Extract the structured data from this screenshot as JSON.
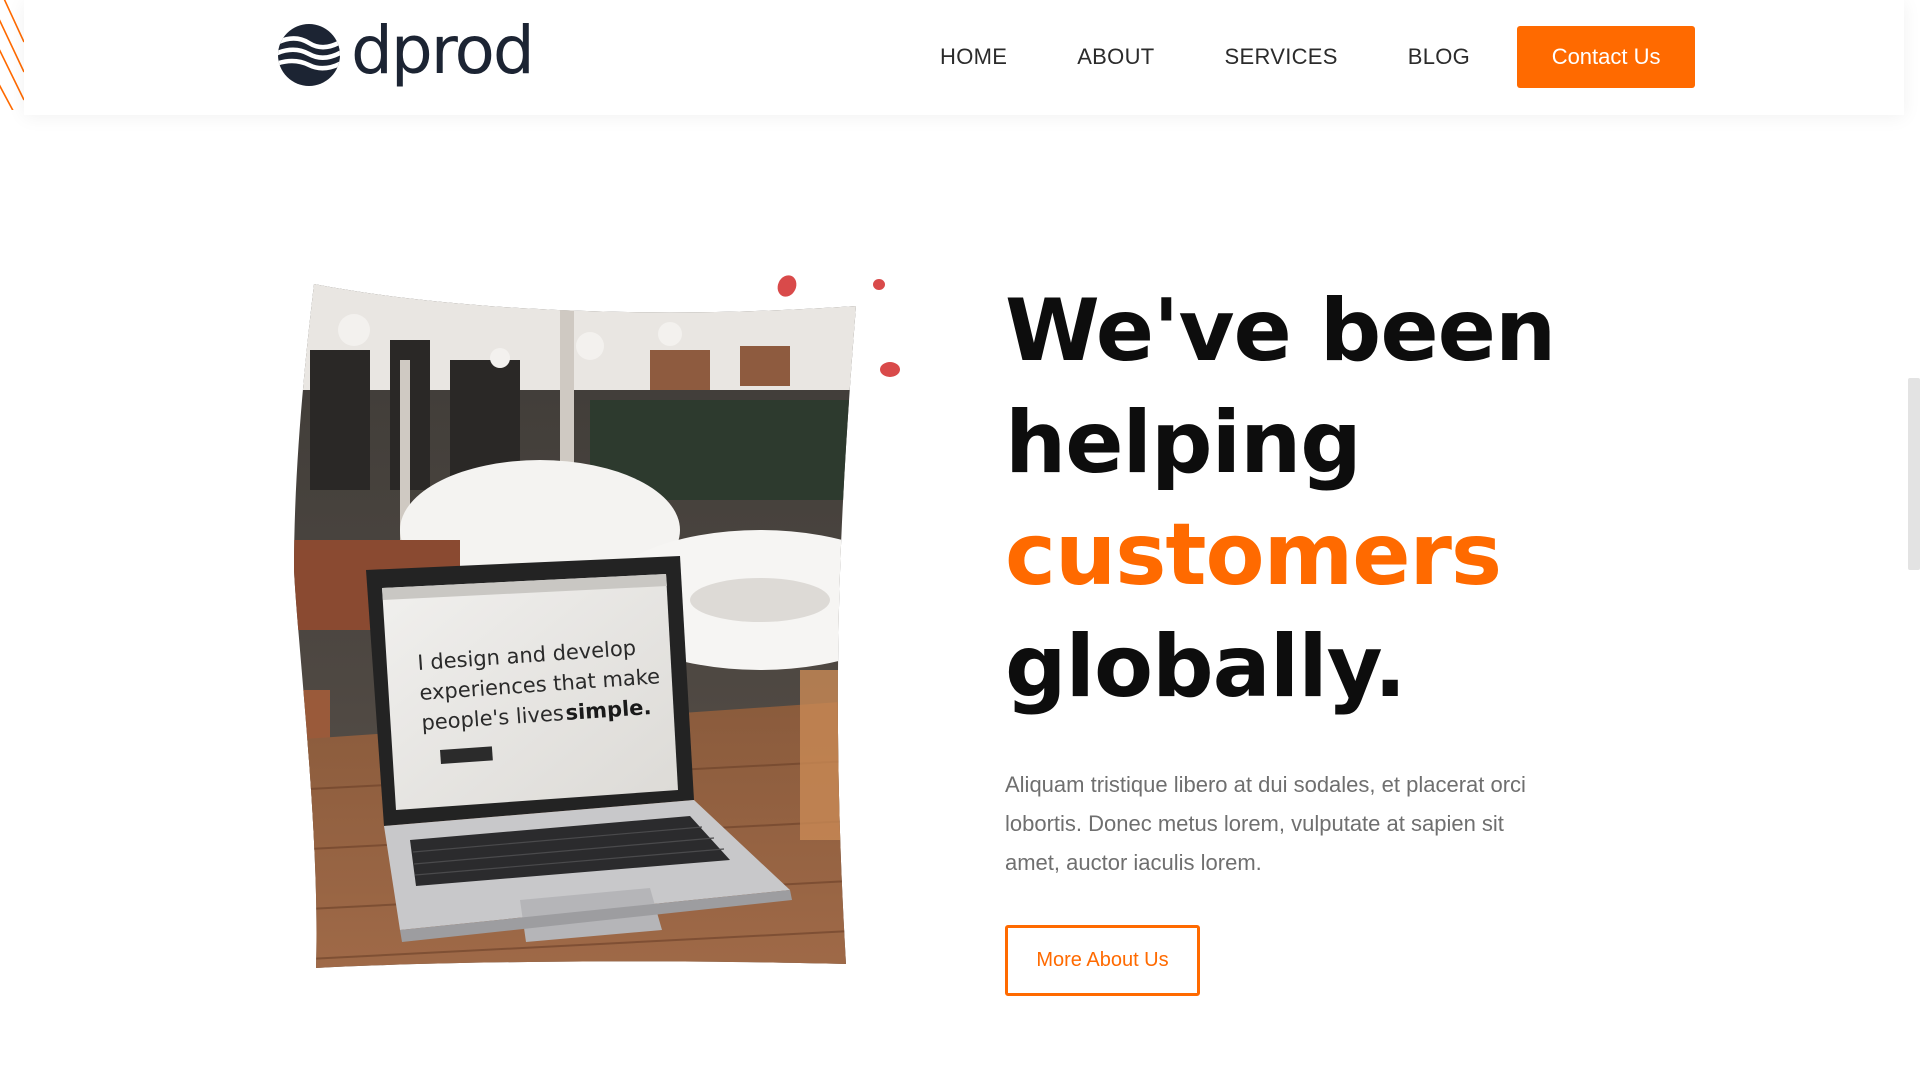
{
  "brand": {
    "name": "dprod",
    "logo_icon": "wave-globe-icon"
  },
  "nav": {
    "items": [
      {
        "label": "HOME"
      },
      {
        "label": "ABOUT"
      },
      {
        "label": "SERVICES"
      },
      {
        "label": "BLOG"
      }
    ],
    "cta_label": "Contact Us"
  },
  "hero": {
    "headline": [
      "We've been",
      "helping",
      "customers",
      "globally."
    ],
    "accent_line": 2,
    "description": "Aliquam tristique libero at dui sodales, et placerat orci lobortis. Donec metus lorem, vulputate at sapien sit amet, auctor iaculis lorem.",
    "button_label": "More About Us",
    "photo": {
      "subject": "laptop-on-cafe-table",
      "screen_text": [
        "I design and develop",
        "experiences that make",
        "people's lives",
        "simple."
      ]
    }
  },
  "colors": {
    "accent": "#ff6a00",
    "dark": "#1c2433",
    "dot": "#d94a4a"
  }
}
